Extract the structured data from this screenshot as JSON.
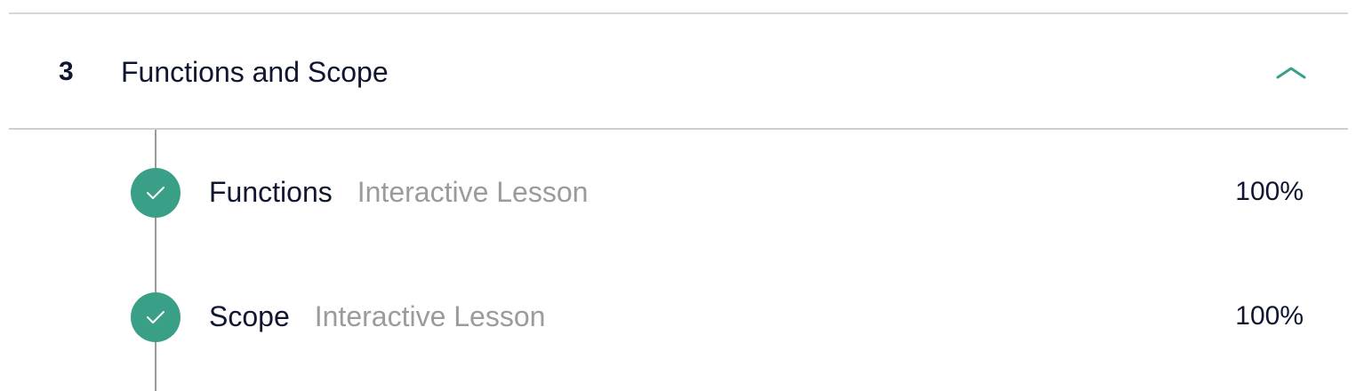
{
  "section": {
    "number": "3",
    "title": "Functions and Scope",
    "expanded": true,
    "chevron_icon": "chevron-up-icon",
    "accent_color": "#3a9f87"
  },
  "lessons": [
    {
      "title": "Functions",
      "type": "Interactive Lesson",
      "progress": "100%",
      "status_icon": "check-icon",
      "completed": true
    },
    {
      "title": "Scope",
      "type": "Interactive Lesson",
      "progress": "100%",
      "status_icon": "check-icon",
      "completed": true
    }
  ]
}
